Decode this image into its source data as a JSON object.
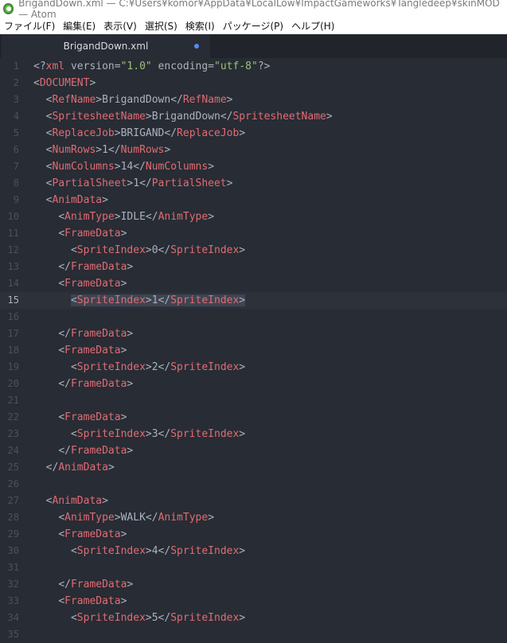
{
  "window": {
    "title": "BrigandDown.xml — C:¥Users¥komor¥AppData¥LocalLow¥ImpactGameworks¥Tangledeep¥skinMOD — Atom"
  },
  "menu": {
    "items": [
      "ファイル(F)",
      "編集(E)",
      "表示(V)",
      "選択(S)",
      "検索(I)",
      "パッケージ(P)",
      "ヘルプ(H)"
    ]
  },
  "tab": {
    "label": "BrigandDown.xml",
    "modified": true,
    "modified_color": "#578af2"
  },
  "editor": {
    "cursor_line": 15,
    "lines": [
      {
        "n": "1",
        "code": "<?xml version=\"1.0\" encoding=\"utf-8\"?>"
      },
      {
        "n": "2",
        "code": "<DOCUMENT>"
      },
      {
        "n": "3",
        "code": "  <RefName>BrigandDown</RefName>"
      },
      {
        "n": "4",
        "code": "  <SpritesheetName>BrigandDown</SpritesheetName>"
      },
      {
        "n": "5",
        "code": "  <ReplaceJob>BRIGAND</ReplaceJob>"
      },
      {
        "n": "6",
        "code": "  <NumRows>1</NumRows>"
      },
      {
        "n": "7",
        "code": "  <NumColumns>14</NumColumns>"
      },
      {
        "n": "8",
        "code": "  <PartialSheet>1</PartialSheet>"
      },
      {
        "n": "9",
        "code": "  <AnimData>"
      },
      {
        "n": "10",
        "code": "    <AnimType>IDLE</AnimType>"
      },
      {
        "n": "11",
        "code": "    <FrameData>"
      },
      {
        "n": "12",
        "code": "      <SpriteIndex>0</SpriteIndex>"
      },
      {
        "n": "13",
        "code": "    </FrameData>"
      },
      {
        "n": "14",
        "code": "    <FrameData>"
      },
      {
        "n": "15",
        "code": "      <SpriteIndex>1</SpriteIndex>"
      },
      {
        "n": "16",
        "code": ""
      },
      {
        "n": "17",
        "code": "    </FrameData>"
      },
      {
        "n": "18",
        "code": "    <FrameData>"
      },
      {
        "n": "19",
        "code": "      <SpriteIndex>2</SpriteIndex>"
      },
      {
        "n": "20",
        "code": "    </FrameData>"
      },
      {
        "n": "21",
        "code": ""
      },
      {
        "n": "22",
        "code": "    <FrameData>"
      },
      {
        "n": "23",
        "code": "      <SpriteIndex>3</SpriteIndex>"
      },
      {
        "n": "24",
        "code": "    </FrameData>"
      },
      {
        "n": "25",
        "code": "  </AnimData>"
      },
      {
        "n": "26",
        "code": ""
      },
      {
        "n": "27",
        "code": "  <AnimData>"
      },
      {
        "n": "28",
        "code": "    <AnimType>WALK</AnimType>"
      },
      {
        "n": "29",
        "code": "    <FrameData>"
      },
      {
        "n": "30",
        "code": "      <SpriteIndex>4</SpriteIndex>"
      },
      {
        "n": "31",
        "code": ""
      },
      {
        "n": "32",
        "code": "    </FrameData>"
      },
      {
        "n": "33",
        "code": "    <FrameData>"
      },
      {
        "n": "34",
        "code": "      <SpriteIndex>5</SpriteIndex>"
      },
      {
        "n": "35",
        "code": ""
      }
    ]
  },
  "colors": {
    "background": "#282c34",
    "tag": "#e06c75",
    "text": "#abb2bf",
    "attribute": "#d19a66",
    "string": "#98c379",
    "line_number": "#495162"
  }
}
